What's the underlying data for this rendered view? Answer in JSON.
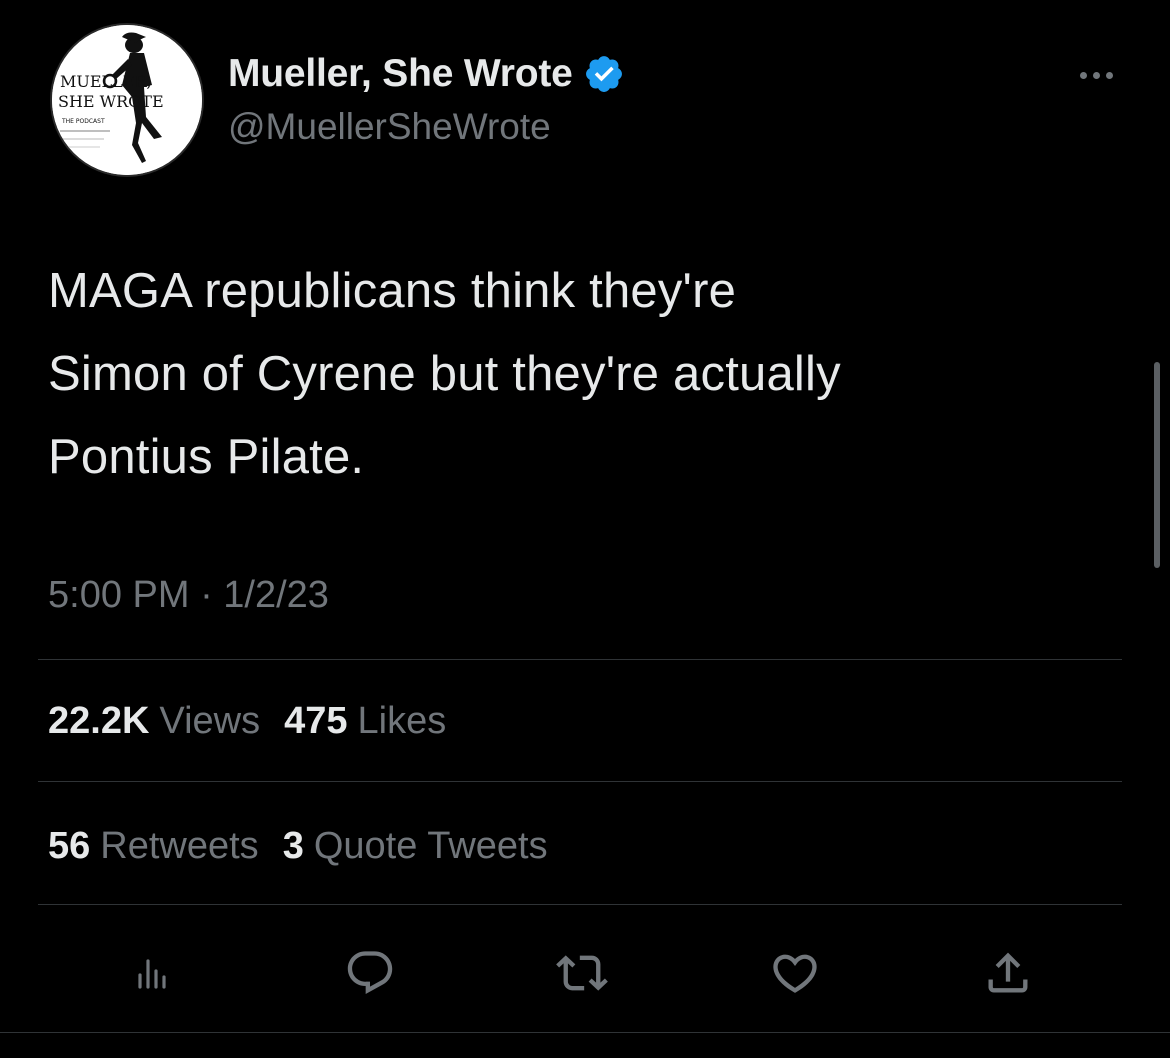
{
  "author": {
    "display_name": "Mueller, She Wrote",
    "handle": "@MuellerSheWrote",
    "verified": true,
    "avatar_text": {
      "line1": "MUELLER,",
      "line2": "SHE WROTE",
      "line3": "THE PODCAST"
    }
  },
  "tweet": {
    "text": "MAGA republicans think they're\nSimon of Cyrene but they're actually\nPontius Pilate.",
    "timestamp": "5:00 PM · 1/2/23"
  },
  "stats": {
    "views_count": "22.2K",
    "views_label": "Views",
    "likes_count": "475",
    "likes_label": "Likes",
    "retweets_count": "56",
    "retweets_label": "Retweets",
    "quotes_count": "3",
    "quotes_label": "Quote Tweets"
  },
  "actions": [
    {
      "icon": "analytics-icon"
    },
    {
      "icon": "reply-icon"
    },
    {
      "icon": "retweet-icon"
    },
    {
      "icon": "like-icon"
    },
    {
      "icon": "share-icon"
    }
  ],
  "colors": {
    "background": "#000000",
    "primary_text": "#e7e9ea",
    "secondary_text": "#71767b",
    "divider": "#2f3336",
    "verified_blue": "#1d9bf0"
  }
}
